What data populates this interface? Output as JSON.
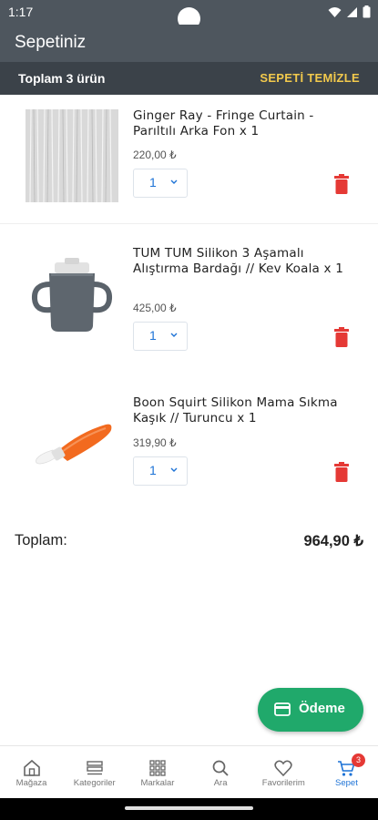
{
  "status_bar": {
    "time": "1:17"
  },
  "app_bar": {
    "title": "Sepetiniz"
  },
  "summary": {
    "count_label": "Toplam 3 ürün",
    "clear_label": "SEPETİ TEMİZLE"
  },
  "items": [
    {
      "name": "Ginger Ray - Fringe Curtain - Parıltılı Arka Fon x 1",
      "price": "220,00 ₺",
      "quantity": "1",
      "thumb_icon": "fringe-curtain-image"
    },
    {
      "name": "TUM TUM Silikon 3 Aşamalı Alıştırma Bardağı // Kev Koala x 1",
      "price": "425,00 ₺",
      "quantity": "1",
      "thumb_icon": "training-cup-image"
    },
    {
      "name": "Boon Squirt Silikon Mama Sıkma Kaşık // Turuncu x 1",
      "price": "319,90 ₺",
      "quantity": "1",
      "thumb_icon": "squeeze-spoon-image"
    }
  ],
  "total": {
    "label": "Toplam:",
    "value": "964,90 ₺"
  },
  "checkout": {
    "label": "Ödeme",
    "color": "#20a96b"
  },
  "bottom_nav": {
    "items": [
      {
        "label": "Mağaza",
        "icon": "store-icon",
        "active": false
      },
      {
        "label": "Kategoriler",
        "icon": "categories-icon",
        "active": false
      },
      {
        "label": "Markalar",
        "icon": "brands-icon",
        "active": false
      },
      {
        "label": "Ara",
        "icon": "search-icon",
        "active": false
      },
      {
        "label": "Favorilerim",
        "icon": "heart-icon",
        "active": false
      },
      {
        "label": "Sepet",
        "icon": "cart-icon",
        "active": true,
        "badge": "3"
      }
    ]
  },
  "colors": {
    "app_bar": "#4e565e",
    "sub_bar": "#3b4249",
    "accent_yellow": "#f2c94c",
    "accent_blue": "#1e73d6",
    "delete_red": "#e53935"
  }
}
